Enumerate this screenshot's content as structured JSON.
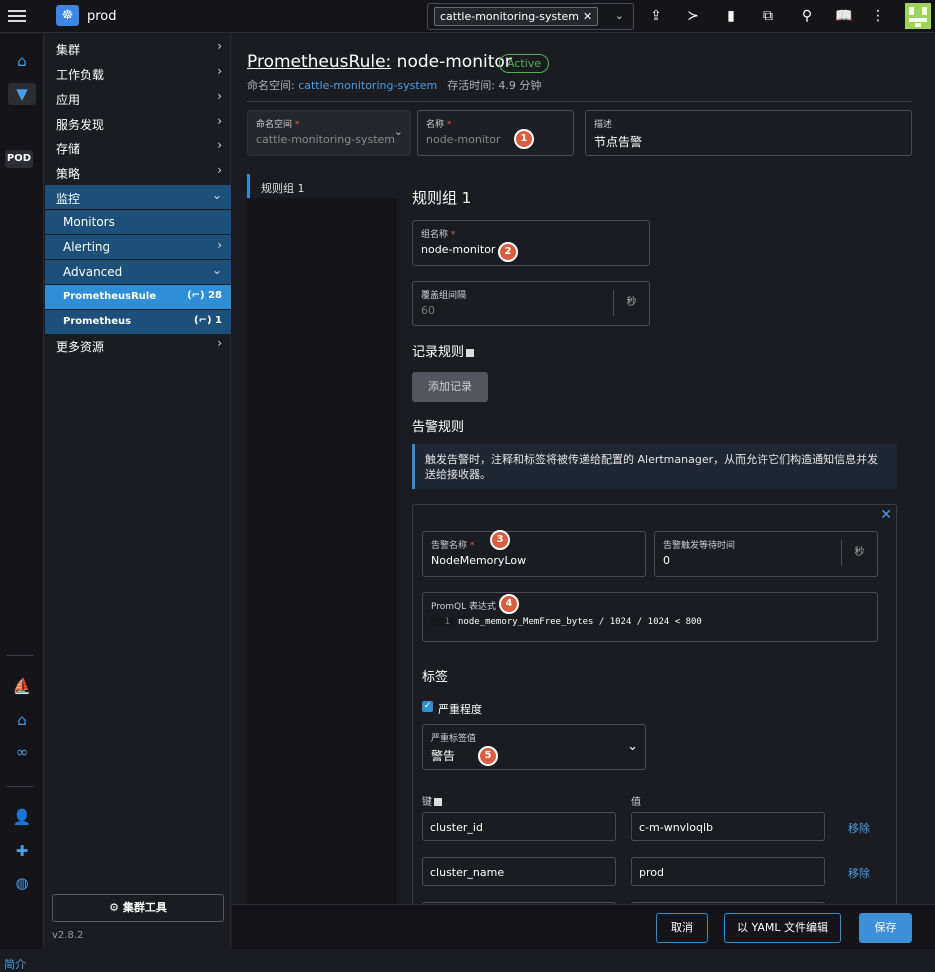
{
  "topbar": {
    "cluster_name": "prod",
    "namespace_tag": "cattle-monitoring-system",
    "icons": [
      "menu-icon",
      "cluster-logo-icon",
      "import-yaml-icon",
      "kubectl-shell-icon",
      "kubeconfig-download-icon",
      "copy-kubeconfig-icon",
      "search-icon",
      "docs-icon",
      "more-icon",
      "user-avatar-icon"
    ]
  },
  "rail": {
    "pod_label": "POD",
    "brief": "简介"
  },
  "sidebar": {
    "items": [
      {
        "label": "集群"
      },
      {
        "label": "工作负载"
      },
      {
        "label": "应用"
      },
      {
        "label": "服务发现"
      },
      {
        "label": "存储"
      },
      {
        "label": "策略"
      },
      {
        "label": "监控"
      },
      {
        "label": "Monitors"
      },
      {
        "label": "Alerting"
      },
      {
        "label": "Advanced"
      },
      {
        "label": "PrometheusRule",
        "count": "(⌐) 28"
      },
      {
        "label": "Prometheus",
        "count": "(⌐) 1"
      },
      {
        "label": "更多资源"
      }
    ],
    "tools_button": "集群工具",
    "version": "v2.8.2"
  },
  "header": {
    "kind": "PrometheusRule:",
    "name": "node-monitor",
    "status": "Active",
    "ns_label": "命名空间: ",
    "ns_value": "cattle-monitoring-system",
    "age": "存活时间: 4.9 分钟"
  },
  "form": {
    "namespace": {
      "label": "命名空间",
      "value": "cattle-monitoring-system"
    },
    "name": {
      "label": "名称",
      "value": "node-monitor"
    },
    "description": {
      "label": "描述",
      "value": "节点告警"
    },
    "tab": "规则组 1",
    "group_title": "规则组 1",
    "group_name": {
      "label": "组名称",
      "value": "node-monitor"
    },
    "interval": {
      "label": "覆盖组间隔",
      "placeholder": "60",
      "unit": "秒"
    },
    "recording_title": "记录规则",
    "add_record": "添加记录",
    "alert_title": "告警规则",
    "info_text": "触发告警时，注释和标签将被传递给配置的 Alertmanager，从而允许它们构造通知信息并发送给接收器。",
    "alert": {
      "name_label": "告警名称",
      "name_value": "NodeMemoryLow",
      "wait_label": "告警触发等待时间",
      "wait_value": "0",
      "wait_unit": "秒",
      "promql_label": "PromQL 表达式",
      "promql_line": "1",
      "promql_value": "node_memory_MemFree_bytes / 1024 / 1024 < 800",
      "labels_title": "标签",
      "severity_check": "严重程度",
      "severity_label": "严重标签值",
      "severity_value": "警告",
      "key_header": "键",
      "value_header": "值",
      "rows": [
        {
          "key": "cluster_id",
          "value": "c-m-wnvloqlb",
          "remove": "移除"
        },
        {
          "key": "cluster_name",
          "value": "prod",
          "remove": "移除"
        }
      ]
    }
  },
  "markers": [
    "1",
    "2",
    "3",
    "4",
    "5"
  ],
  "footer": {
    "cancel": "取消",
    "yaml": "以 YAML 文件编辑",
    "save": "保存"
  }
}
